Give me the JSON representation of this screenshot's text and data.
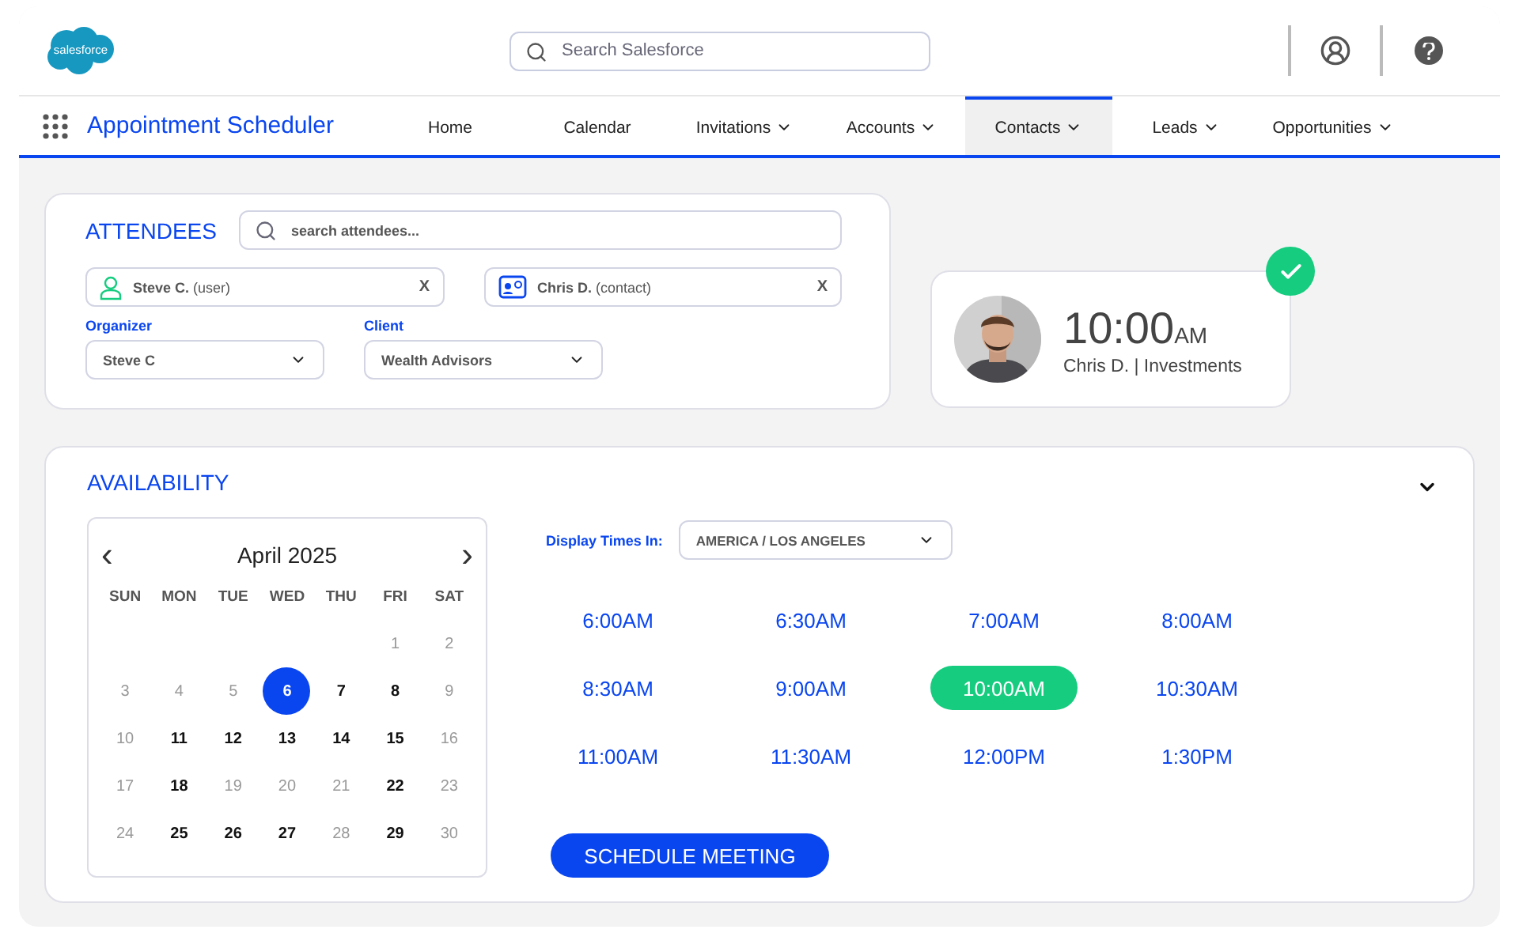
{
  "header": {
    "logo_text": "salesforce",
    "search": {
      "placeholder": "Search Salesforce"
    }
  },
  "nav": {
    "app_title": "Appointment Scheduler",
    "items": [
      {
        "label": "Home",
        "has_menu": false,
        "selected": false
      },
      {
        "label": "Calendar",
        "has_menu": false,
        "selected": false
      },
      {
        "label": "Invitations",
        "has_menu": true,
        "selected": false
      },
      {
        "label": "Accounts",
        "has_menu": true,
        "selected": false
      },
      {
        "label": "Contacts",
        "has_menu": true,
        "selected": true
      },
      {
        "label": "Leads",
        "has_menu": true,
        "selected": false
      },
      {
        "label": "Opportunities",
        "has_menu": true,
        "selected": false
      }
    ]
  },
  "attendees": {
    "title": "ATTENDEES",
    "search": {
      "placeholder": "search attendees..."
    },
    "chips": [
      {
        "kind": "user",
        "name": "Steve C.",
        "role": "(user)",
        "remove": "X"
      },
      {
        "kind": "contact",
        "name": "Chris D.",
        "role": "(contact)",
        "remove": "X"
      }
    ],
    "selects": [
      {
        "label": "Organizer",
        "value": "Steve C"
      },
      {
        "label": "Client",
        "value": "Wealth Advisors"
      }
    ]
  },
  "appointment": {
    "confirmed": true,
    "time": "10:00",
    "period": "AM",
    "subtitle": "Chris D. | Investments"
  },
  "availability": {
    "title": "AVAILABILITY",
    "expanded": true,
    "calendar": {
      "prev": "‹",
      "month": "April 2025",
      "next": "›",
      "weekdays": [
        "SUN",
        "MON",
        "TUE",
        "WED",
        "THU",
        "FRI",
        "SAT"
      ],
      "weeks": [
        {
          "days": [
            {
              "label": "1",
              "available": false,
              "selected": false
            },
            {
              "label": "2",
              "available": false,
              "selected": false
            }
          ]
        },
        {
          "days": [
            {
              "label": "3",
              "available": false,
              "selected": false
            },
            {
              "label": "4",
              "available": false,
              "selected": false
            },
            {
              "label": "5",
              "available": false,
              "selected": false
            },
            {
              "label": "6",
              "available": true,
              "selected": true
            },
            {
              "label": "7",
              "available": true,
              "selected": false
            },
            {
              "label": "8",
              "available": true,
              "selected": false
            },
            {
              "label": "9",
              "available": false,
              "selected": false
            }
          ]
        },
        {
          "days": [
            {
              "label": "10",
              "available": false,
              "selected": false
            },
            {
              "label": "11",
              "available": true,
              "selected": false
            },
            {
              "label": "12",
              "available": true,
              "selected": false
            },
            {
              "label": "13",
              "available": true,
              "selected": false
            },
            {
              "label": "14",
              "available": true,
              "selected": false
            },
            {
              "label": "15",
              "available": true,
              "selected": false
            },
            {
              "label": "16",
              "available": false,
              "selected": false
            }
          ]
        },
        {
          "days": [
            {
              "label": "17",
              "available": false,
              "selected": false
            },
            {
              "label": "18",
              "available": true,
              "selected": false
            },
            {
              "label": "19",
              "available": false,
              "selected": false
            },
            {
              "label": "20",
              "available": false,
              "selected": false
            },
            {
              "label": "21",
              "available": false,
              "selected": false
            },
            {
              "label": "22",
              "available": true,
              "selected": false
            },
            {
              "label": "23",
              "available": false,
              "selected": false
            }
          ]
        },
        {
          "days": [
            {
              "label": "24",
              "available": false,
              "selected": false
            },
            {
              "label": "25",
              "available": true,
              "selected": false
            },
            {
              "label": "26",
              "available": true,
              "selected": false
            },
            {
              "label": "27",
              "available": true,
              "selected": false
            },
            {
              "label": "28",
              "available": false,
              "selected": false
            },
            {
              "label": "29",
              "available": true,
              "selected": false
            },
            {
              "label": "30",
              "available": false,
              "selected": false
            }
          ]
        }
      ]
    },
    "timezone": {
      "label": "Display Times In:",
      "value": "AMERICA / LOS ANGELES"
    },
    "slots": [
      {
        "label": "6:00AM",
        "selected": false
      },
      {
        "label": "6:30AM",
        "selected": false
      },
      {
        "label": "7:00AM",
        "selected": false
      },
      {
        "label": "8:00AM",
        "selected": false
      },
      {
        "label": "8:30AM",
        "selected": false
      },
      {
        "label": "9:00AM",
        "selected": false
      },
      {
        "label": "10:00AM",
        "selected": true
      },
      {
        "label": "10:30AM",
        "selected": false
      },
      {
        "label": "11:00AM",
        "selected": false
      },
      {
        "label": "11:30AM",
        "selected": false
      },
      {
        "label": "12:00PM",
        "selected": false
      },
      {
        "label": "1:30PM",
        "selected": false
      }
    ],
    "action": "SCHEDULE MEETING"
  }
}
